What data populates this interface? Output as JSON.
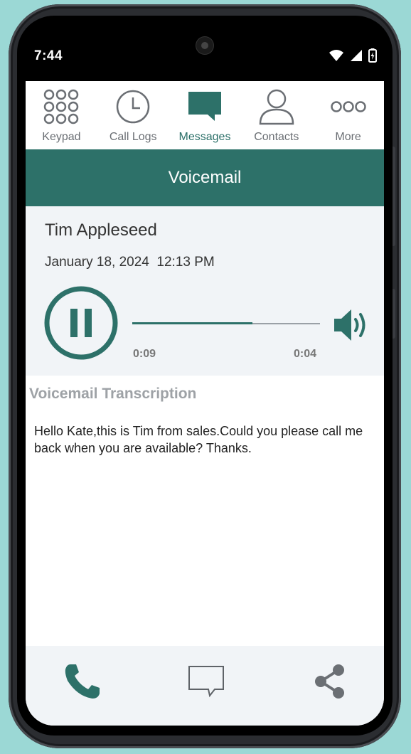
{
  "status_bar": {
    "time": "7:44",
    "icons": [
      "wifi-icon",
      "signal-icon",
      "battery-charging-icon"
    ]
  },
  "tabs": [
    {
      "label": "Keypad",
      "icon": "keypad-icon",
      "active": false
    },
    {
      "label": "Call Logs",
      "icon": "clock-icon",
      "active": false
    },
    {
      "label": "Messages",
      "icon": "message-icon",
      "active": true
    },
    {
      "label": "Contacts",
      "icon": "person-icon",
      "active": false
    },
    {
      "label": "More",
      "icon": "more-icon",
      "active": false
    }
  ],
  "header": {
    "title": "Voicemail"
  },
  "voicemail": {
    "caller": "Tim Appleseed",
    "date": "January 18, 2024",
    "time": "12:13 PM",
    "elapsed": "0:09",
    "remaining": "0:04",
    "progress_fraction": 0.64
  },
  "transcription": {
    "title": "Voicemail Transcription",
    "text": "Hello Kate,this is Tim from sales.Could you please call me back when you are available? Thanks."
  },
  "bottom_actions": [
    "phone-icon",
    "comment-icon",
    "share-icon"
  ],
  "colors": {
    "accent": "#2d7169",
    "panel_bg": "#f1f4f7",
    "muted_text": "#9ea2a6",
    "background": "#9bd8d5"
  }
}
